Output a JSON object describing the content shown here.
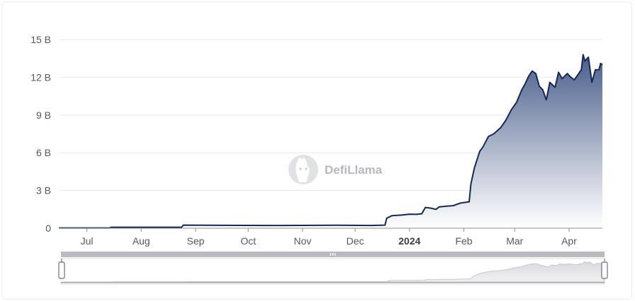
{
  "watermark": {
    "text": "DefiLlama",
    "icon": "llama-logo-icon"
  },
  "colors": {
    "line": "#14285a",
    "area_top": "#3f5584",
    "area_bottom": "#ffffff",
    "grid": "#e6e8ef",
    "zoom_bar": "#b9bbc0"
  },
  "chart_data": {
    "type": "area",
    "title": "",
    "xlabel": "",
    "ylabel": "",
    "ylim": [
      0,
      15000000000
    ],
    "yticks": [
      {
        "value": 0,
        "label": "0"
      },
      {
        "value": 3000000000,
        "label": "3 B"
      },
      {
        "value": 6000000000,
        "label": "6 B"
      },
      {
        "value": 9000000000,
        "label": "9 B"
      },
      {
        "value": 12000000000,
        "label": "12 B"
      },
      {
        "value": 15000000000,
        "label": "15 B"
      }
    ],
    "xlim": [
      "2023-06-15",
      "2024-04-20"
    ],
    "xticks": [
      {
        "date": "2023-07-01",
        "label": "Jul",
        "bold": false
      },
      {
        "date": "2023-08-01",
        "label": "Aug",
        "bold": false
      },
      {
        "date": "2023-09-01",
        "label": "Sep",
        "bold": false
      },
      {
        "date": "2023-10-01",
        "label": "Oct",
        "bold": false
      },
      {
        "date": "2023-11-01",
        "label": "Nov",
        "bold": false
      },
      {
        "date": "2023-12-01",
        "label": "Dec",
        "bold": false
      },
      {
        "date": "2024-01-01",
        "label": "2024",
        "bold": true
      },
      {
        "date": "2024-02-01",
        "label": "Feb",
        "bold": false
      },
      {
        "date": "2024-03-01",
        "label": "Mar",
        "bold": false
      },
      {
        "date": "2024-04-01",
        "label": "Apr",
        "bold": false
      }
    ],
    "grid": true,
    "legend": "none",
    "series": [
      {
        "points": [
          [
            "2023-06-15",
            0.02
          ],
          [
            "2023-07-14",
            0.02
          ],
          [
            "2023-07-15",
            0.08
          ],
          [
            "2023-08-20",
            0.08
          ],
          [
            "2023-08-24",
            0.08
          ],
          [
            "2023-08-25",
            0.25
          ],
          [
            "2023-09-15",
            0.23
          ],
          [
            "2023-10-20",
            0.22
          ],
          [
            "2023-11-20",
            0.24
          ],
          [
            "2023-12-10",
            0.22
          ],
          [
            "2023-12-18",
            0.25
          ],
          [
            "2023-12-19",
            0.8
          ],
          [
            "2023-12-22",
            1.0
          ],
          [
            "2023-12-28",
            1.05
          ],
          [
            "2024-01-01",
            1.12
          ],
          [
            "2024-01-05",
            1.1
          ],
          [
            "2024-01-08",
            1.15
          ],
          [
            "2024-01-10",
            1.65
          ],
          [
            "2024-01-13",
            1.6
          ],
          [
            "2024-01-16",
            1.5
          ],
          [
            "2024-01-18",
            1.7
          ],
          [
            "2024-01-22",
            1.75
          ],
          [
            "2024-01-26",
            1.8
          ],
          [
            "2024-01-30",
            2.0
          ],
          [
            "2024-02-04",
            2.1
          ],
          [
            "2024-02-05",
            3.5
          ],
          [
            "2024-02-07",
            4.8
          ],
          [
            "2024-02-10",
            6.1
          ],
          [
            "2024-02-12",
            6.5
          ],
          [
            "2024-02-15",
            7.3
          ],
          [
            "2024-02-18",
            7.5
          ],
          [
            "2024-02-22",
            8.0
          ],
          [
            "2024-02-25",
            8.6
          ],
          [
            "2024-02-28",
            9.4
          ],
          [
            "2024-03-02",
            10.0
          ],
          [
            "2024-03-05",
            11.0
          ],
          [
            "2024-03-07",
            11.5
          ],
          [
            "2024-03-09",
            12.1
          ],
          [
            "2024-03-11",
            12.5
          ],
          [
            "2024-03-13",
            12.3
          ],
          [
            "2024-03-15",
            11.3
          ],
          [
            "2024-03-17",
            11.0
          ],
          [
            "2024-03-19",
            10.2
          ],
          [
            "2024-03-21",
            11.6
          ],
          [
            "2024-03-24",
            11.2
          ],
          [
            "2024-03-26",
            12.4
          ],
          [
            "2024-03-28",
            11.9
          ],
          [
            "2024-03-31",
            12.3
          ],
          [
            "2024-04-02",
            12.0
          ],
          [
            "2024-04-04",
            11.8
          ],
          [
            "2024-04-06",
            12.2
          ],
          [
            "2024-04-08",
            12.6
          ],
          [
            "2024-04-09",
            13.8
          ],
          [
            "2024-04-10",
            13.3
          ],
          [
            "2024-04-12",
            13.6
          ],
          [
            "2024-04-14",
            11.6
          ],
          [
            "2024-04-16",
            12.6
          ],
          [
            "2024-04-18",
            12.6
          ],
          [
            "2024-04-19",
            13.1
          ],
          [
            "2024-04-20",
            13.0
          ]
        ],
        "unit": "billions"
      }
    ]
  }
}
